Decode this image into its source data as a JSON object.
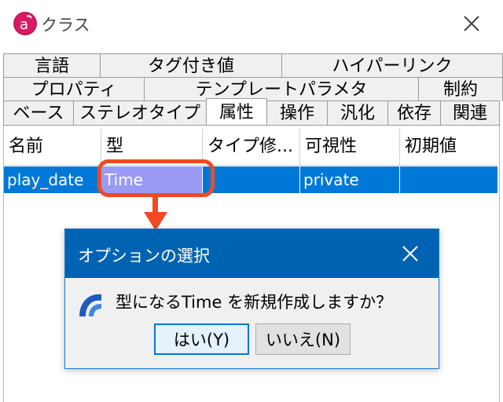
{
  "window": {
    "title": "クラス",
    "app_icon": "astah-logo-icon",
    "close_icon": "close-icon"
  },
  "tabs": {
    "row1": [
      {
        "label": "言語"
      },
      {
        "label": "タグ付き値"
      },
      {
        "label": "ハイパーリンク"
      }
    ],
    "row2": [
      {
        "label": "プロパティ"
      },
      {
        "label": "テンプレートパラメタ"
      },
      {
        "label": "制約"
      }
    ],
    "row3": [
      {
        "label": "ベース"
      },
      {
        "label": "ステレオタイプ"
      },
      {
        "label": "属性"
      },
      {
        "label": "操作"
      },
      {
        "label": "汎化"
      },
      {
        "label": "依存"
      },
      {
        "label": "関連"
      }
    ],
    "active": "属性"
  },
  "grid": {
    "columns": [
      "名前",
      "型",
      "タイプ修...",
      "可視性",
      "初期値"
    ],
    "rows": [
      {
        "name": "play_date",
        "type": "Time",
        "modifier": "",
        "visibility": "private",
        "initial": ""
      }
    ]
  },
  "dialog": {
    "title": "オプションの選択",
    "message": "型になるTime  を新規作成しますか？",
    "yes_label": "はい(Y)",
    "no_label": "いいえ(N)",
    "icon": "astah-question-icon"
  },
  "colors": {
    "selection": "#0078d7",
    "editing_cell": "#9b9bf5",
    "annotation": "#f04a23",
    "dialog_title_bg": "#0063b1"
  }
}
